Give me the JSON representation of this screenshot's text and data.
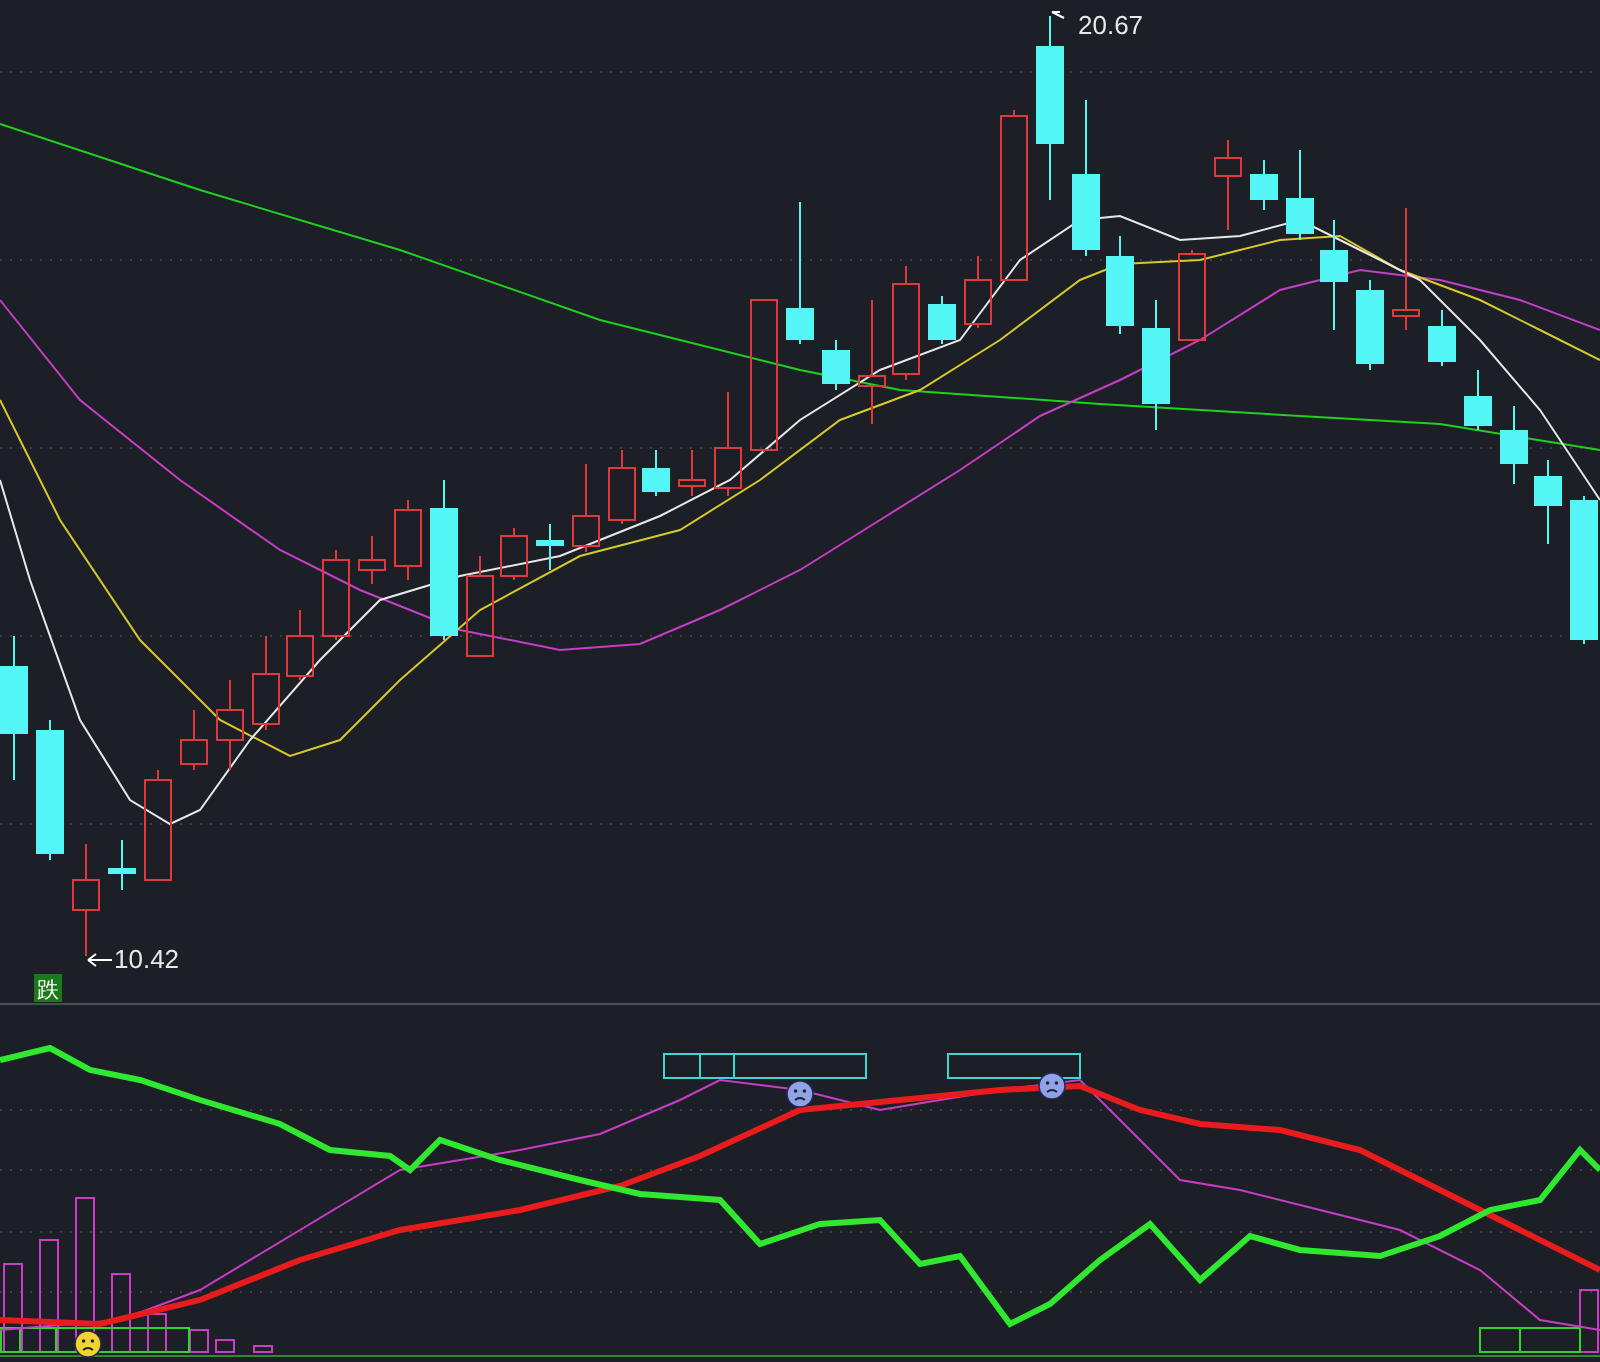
{
  "price_chart": {
    "high_label": "20.67",
    "low_label": "10.42",
    "signal_badge": "跌"
  }
}
